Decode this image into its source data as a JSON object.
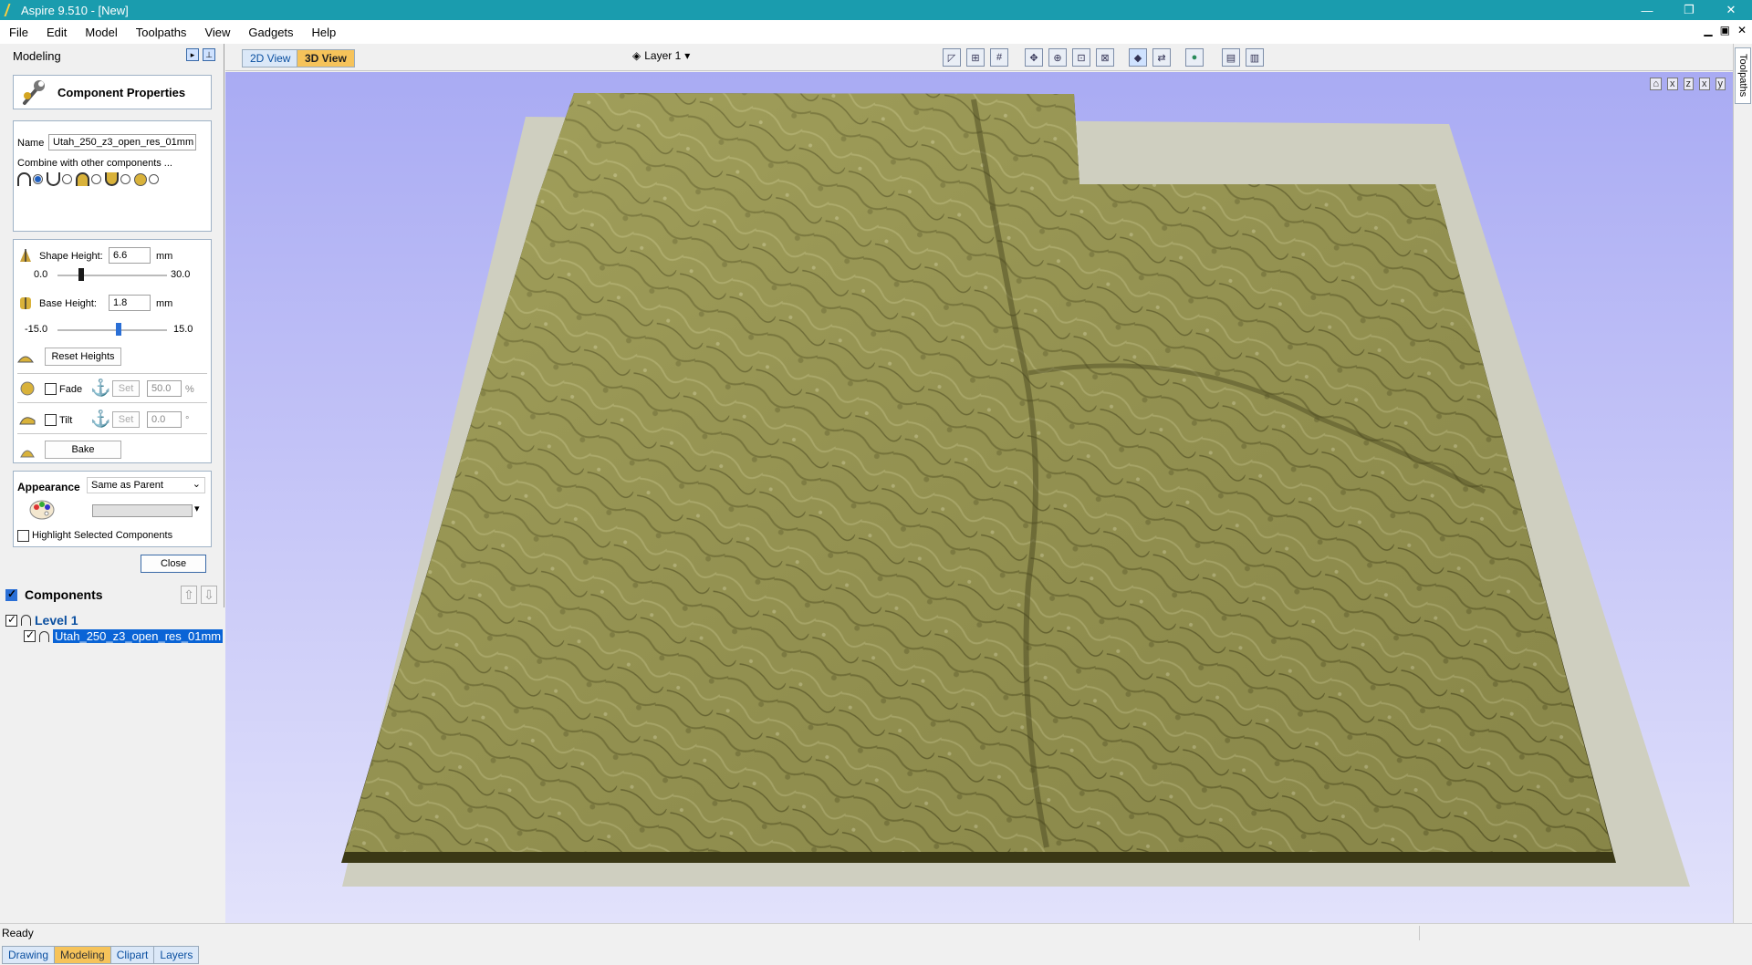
{
  "window": {
    "title": "Aspire 9.510 - [New]",
    "min": "—",
    "max": "❐",
    "close": "✕"
  },
  "menu": [
    "File",
    "Edit",
    "Model",
    "Toolpaths",
    "View",
    "Gadgets",
    "Help"
  ],
  "mdi": {
    "min": "▁",
    "restore": "▣",
    "close": "✕"
  },
  "panel": {
    "title": "Modeling",
    "component_properties": "Component Properties",
    "name_label": "Name",
    "name_value": "Utah_250_z3_open_res_01mm",
    "combine_label": "Combine with other components ...",
    "shape_height_label": "Shape Height:",
    "shape_height_value": "6.6",
    "shape_height_unit": "mm",
    "shape_min": "0.0",
    "shape_max": "30.0",
    "shape_slider_fraction": 0.22,
    "base_height_label": "Base Height:",
    "base_height_value": "1.8",
    "base_height_unit": "mm",
    "base_min": "-15.0",
    "base_max": "15.0",
    "base_slider_fraction": 0.56,
    "reset_heights": "Reset Heights",
    "fade_label": "Fade",
    "fade_set": "Set",
    "fade_value": "50.0",
    "fade_unit": "%",
    "tilt_label": "Tilt",
    "tilt_set": "Set",
    "tilt_value": "0.0",
    "tilt_unit": "°",
    "bake": "Bake",
    "appearance_label": "Appearance",
    "appearance_value": "Same as Parent",
    "highlight_label": "Highlight Selected Components",
    "close": "Close"
  },
  "components": {
    "title": "Components",
    "up": "⇧",
    "down": "⇩",
    "level": "Level 1",
    "item": "Utah_250_z3_open_res_01mm"
  },
  "bottom_tabs": [
    "Drawing",
    "Modeling",
    "Clipart",
    "Layers"
  ],
  "view_tabs": [
    "2D View",
    "3D View"
  ],
  "layer": "Layer 1",
  "axis_buttons": [
    "⌂",
    "x",
    "z",
    "x",
    "y"
  ],
  "toolpaths_tab": "Toolpaths",
  "status": "Ready",
  "colors": {
    "titlebar": "#1a9cae",
    "terrain": "#9c9a55",
    "base_plate": "#cfcfc0",
    "accent_tab": "#f6c35a",
    "selection": "#0a64d6"
  }
}
